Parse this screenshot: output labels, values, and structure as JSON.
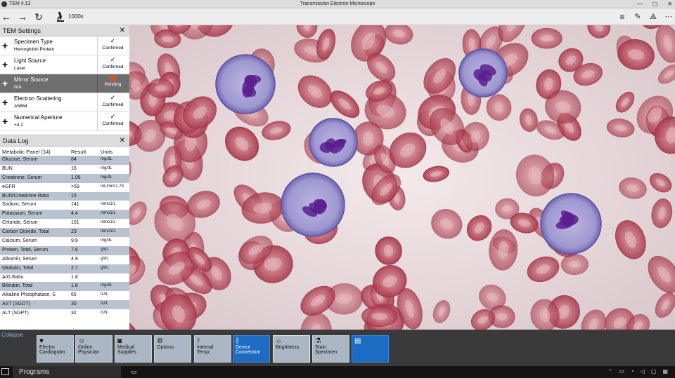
{
  "window": {
    "app_title": "TEM  4.13",
    "title": "Transmission Electron Microscope",
    "controls": [
      "—",
      "▢",
      "✕"
    ]
  },
  "toolbar": {
    "zoom": "1000x"
  },
  "settings": {
    "title": "TEM Settings",
    "items": [
      {
        "name": "Specimen Type",
        "value": "Hemoglobin Protein",
        "status": "Confirmed"
      },
      {
        "name": "Light Source",
        "value": "Laser",
        "status": "Confirmed"
      },
      {
        "name": "Mirror Source",
        "value": "N/A",
        "status": "Pending"
      },
      {
        "name": "Electron Scattering",
        "value": "A5864",
        "status": "Confirmed"
      },
      {
        "name": "Numerical Aperture",
        "value": "+4.2",
        "status": "Confirmed"
      }
    ]
  },
  "datalog": {
    "title": "Data Log",
    "columns": [
      "Metabolic Panel (14)",
      "Result",
      "Units"
    ],
    "rows": [
      [
        "Glucose, Serum",
        "84",
        "mg/dL"
      ],
      [
        "BUN",
        "16",
        "mg/dL"
      ],
      [
        "Creatinine, Serum",
        "1.06",
        "mg/dL"
      ],
      [
        "eGFR",
        ">59",
        "mL/min/1.73"
      ],
      [
        "BUN/Creatinine Ratio",
        "15",
        ""
      ],
      [
        "Sodium, Serum",
        "141",
        "mmo1/L"
      ],
      [
        "Potassium, Serum",
        "4.4",
        "mmo1/L"
      ],
      [
        "Chloride, Serum",
        "101",
        "mmo1/L"
      ],
      [
        "Carbon Dioxide, Total",
        "23",
        "mmo1/L"
      ],
      [
        "Calcium, Serum",
        "9.9",
        "mg/dL"
      ],
      [
        "Protein, Total, Serum",
        "7.6",
        "g/dL"
      ],
      [
        "Albumin, Serum",
        "4.9",
        "g/dL"
      ],
      [
        "Globulin, Total",
        "2.7",
        "g/dL"
      ],
      [
        "A/G Ratio",
        "1.8",
        ""
      ],
      [
        "Bilirubin, Total",
        "1.8",
        "mg/dL"
      ],
      [
        "Alkaline Phosphatase, S",
        "65",
        "IU/L"
      ],
      [
        "AST (SGOT)",
        "30",
        "IU/L"
      ],
      [
        "ALT (SGPT)",
        "32",
        "IU/L"
      ]
    ]
  },
  "bottombar": {
    "collapse": "Collapse",
    "tools": [
      {
        "line1": "Electro",
        "line2": "Cardiogram",
        "icon": "heart-icon"
      },
      {
        "line1": "Online",
        "line2": "Physician",
        "icon": "user-icon"
      },
      {
        "line1": "Medical",
        "line2": "Supplies",
        "icon": "camera-icon"
      },
      {
        "line1": "Options",
        "line2": "",
        "icon": "gear-icon"
      },
      {
        "line1": "Internal",
        "line2": "Temp.",
        "icon": "thermometer-icon"
      },
      {
        "line1": "Device",
        "line2": "Connection",
        "icon": "bluetooth-icon"
      },
      {
        "line1": "Brightness",
        "line2": "",
        "icon": "sun-icon"
      },
      {
        "line1": "Stain",
        "line2": "Specimen",
        "icon": "flask-icon"
      },
      {
        "line1": "",
        "line2": "",
        "icon": "clipboard-icon"
      }
    ]
  },
  "taskbar": {
    "programs": "Programs"
  }
}
